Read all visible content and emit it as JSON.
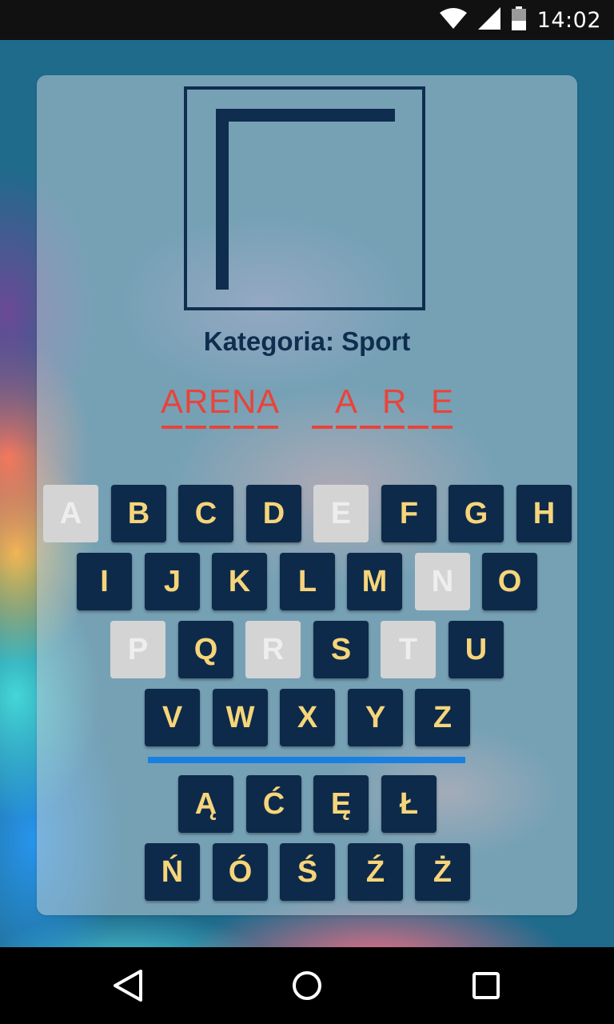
{
  "status_bar": {
    "time": "14:02",
    "icons": [
      "wifi-icon",
      "signal-icon",
      "battery-icon"
    ]
  },
  "game": {
    "category_label": "Kategoria: Sport",
    "words": [
      [
        "A",
        "R",
        "E",
        "N",
        "A"
      ],
      [
        "",
        "A",
        "",
        "R",
        "",
        "E"
      ]
    ],
    "hangman_stage": 2
  },
  "keyboard": {
    "rows": [
      [
        {
          "label": "A",
          "used": true
        },
        {
          "label": "B",
          "used": false
        },
        {
          "label": "C",
          "used": false
        },
        {
          "label": "D",
          "used": false
        },
        {
          "label": "E",
          "used": true
        },
        {
          "label": "F",
          "used": false
        },
        {
          "label": "G",
          "used": false
        },
        {
          "label": "H",
          "used": false
        }
      ],
      [
        {
          "label": "I",
          "used": false
        },
        {
          "label": "J",
          "used": false
        },
        {
          "label": "K",
          "used": false
        },
        {
          "label": "L",
          "used": false
        },
        {
          "label": "M",
          "used": false
        },
        {
          "label": "N",
          "used": true
        },
        {
          "label": "O",
          "used": false
        }
      ],
      [
        {
          "label": "P",
          "used": true
        },
        {
          "label": "Q",
          "used": false
        },
        {
          "label": "R",
          "used": true
        },
        {
          "label": "S",
          "used": false
        },
        {
          "label": "T",
          "used": true
        },
        {
          "label": "U",
          "used": false
        }
      ],
      [
        {
          "label": "V",
          "used": false
        },
        {
          "label": "W",
          "used": false
        },
        {
          "label": "X",
          "used": false
        },
        {
          "label": "Y",
          "used": false
        },
        {
          "label": "Z",
          "used": false
        }
      ],
      [
        {
          "label": "Ą",
          "used": false
        },
        {
          "label": "Ć",
          "used": false
        },
        {
          "label": "Ę",
          "used": false
        },
        {
          "label": "Ł",
          "used": false
        }
      ],
      [
        {
          "label": "Ń",
          "used": false
        },
        {
          "label": "Ó",
          "used": false
        },
        {
          "label": "Ś",
          "used": false
        },
        {
          "label": "Ź",
          "used": false
        },
        {
          "label": "Ż",
          "used": false
        }
      ]
    ]
  },
  "colors": {
    "key_bg": "#0e2a4a",
    "key_text": "#f6d57a",
    "key_used_bg": "#d4d4d4",
    "word_color": "#e8443a",
    "divider": "#1a7fe0",
    "title_color": "#0f2e4f"
  },
  "nav_bar": {
    "icons": [
      "back-icon",
      "home-icon",
      "recents-icon"
    ]
  }
}
